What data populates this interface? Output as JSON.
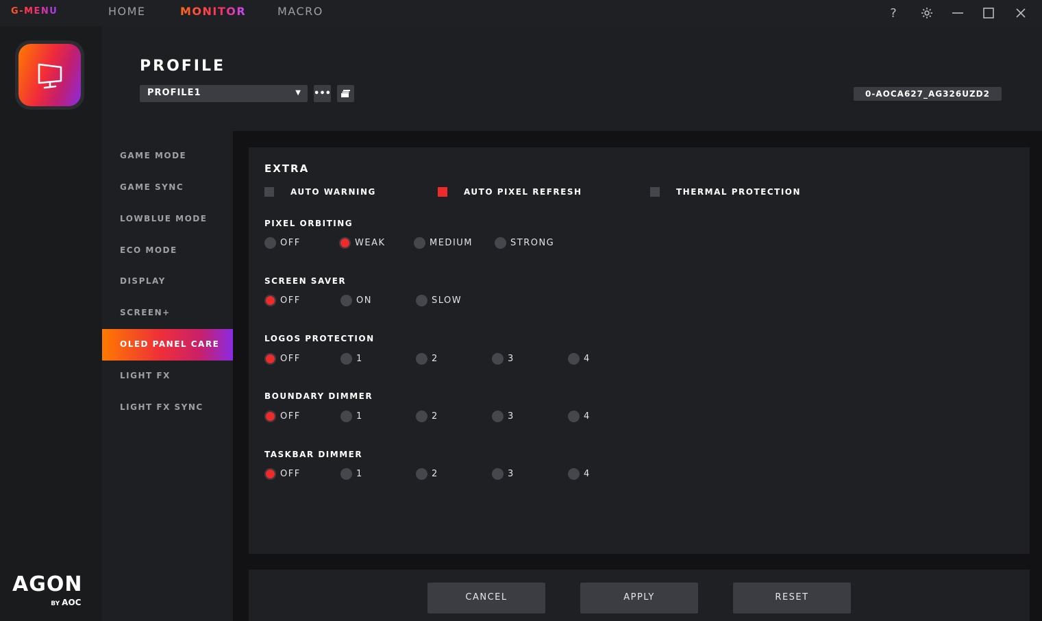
{
  "app": {
    "brand": "G-MENU",
    "nav": [
      {
        "label": "HOME",
        "active": false
      },
      {
        "label": "MONITOR",
        "active": true
      },
      {
        "label": "MACRO",
        "active": false
      }
    ],
    "window_icons": [
      "help-icon",
      "gear-icon",
      "minimize-icon",
      "maximize-icon",
      "close-icon"
    ],
    "help_glyph": "?"
  },
  "branding": {
    "agon": "AGON",
    "by": "BY",
    "aoc": "AOC"
  },
  "profile": {
    "title": "PROFILE",
    "selected": "PROFILE1",
    "more_glyph": "•••",
    "monitor_id": "0-AOCA627_AG326UZD2"
  },
  "menu": [
    {
      "label": "GAME MODE",
      "active": false
    },
    {
      "label": "GAME SYNC",
      "active": false
    },
    {
      "label": "LOWBLUE MODE",
      "active": false
    },
    {
      "label": "ECO MODE",
      "active": false
    },
    {
      "label": "DISPLAY",
      "active": false
    },
    {
      "label": "SCREEN+",
      "active": false
    },
    {
      "label": "OLED PANEL CARE",
      "active": true
    },
    {
      "label": "LIGHT FX",
      "active": false
    },
    {
      "label": "LIGHT FX SYNC",
      "active": false
    }
  ],
  "extra": {
    "title": "EXTRA",
    "checks": [
      {
        "label": "AUTO WARNING",
        "checked": false
      },
      {
        "label": "AUTO PIXEL REFRESH",
        "checked": true
      },
      {
        "label": "THERMAL PROTECTION",
        "checked": false
      }
    ]
  },
  "sections": [
    {
      "title": "PIXEL ORBITING",
      "options": [
        "OFF",
        "WEAK",
        "MEDIUM",
        "STRONG"
      ],
      "selected": "WEAK"
    },
    {
      "title": "SCREEN SAVER",
      "options": [
        "OFF",
        "ON",
        "SLOW"
      ],
      "selected": "OFF"
    },
    {
      "title": "LOGOS PROTECTION",
      "options": [
        "OFF",
        "1",
        "2",
        "3",
        "4"
      ],
      "selected": "OFF"
    },
    {
      "title": "BOUNDARY DIMMER",
      "options": [
        "OFF",
        "1",
        "2",
        "3",
        "4"
      ],
      "selected": "OFF"
    },
    {
      "title": "TASKBAR DIMMER",
      "options": [
        "OFF",
        "1",
        "2",
        "3",
        "4"
      ],
      "selected": "OFF"
    }
  ],
  "actions": {
    "cancel": "CANCEL",
    "apply": "APPLY",
    "reset": "RESET"
  },
  "colors": {
    "accent": "#ee2a2a",
    "gradient_start": "#ff7a00",
    "gradient_end": "#8a2be2"
  }
}
